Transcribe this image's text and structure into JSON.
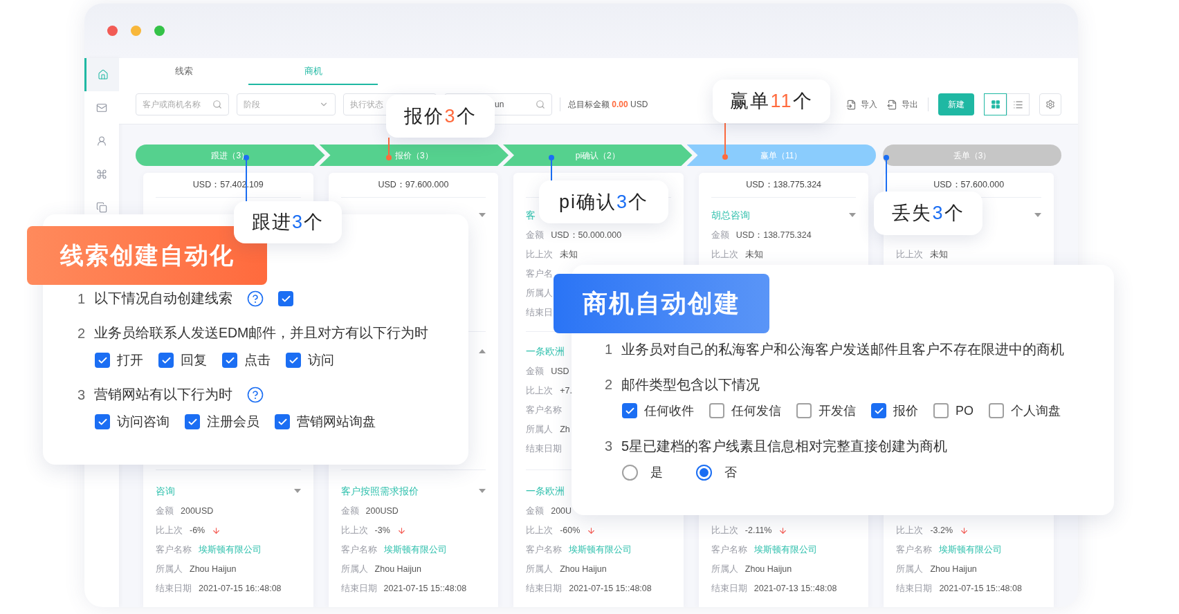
{
  "window": {
    "controls": [
      {
        "kind": "close"
      },
      {
        "kind": "minimize"
      },
      {
        "kind": "maximize"
      }
    ]
  },
  "sidebar": {
    "items": [
      {
        "kind": "home",
        "selected": true
      },
      {
        "kind": "mail",
        "selected": false
      },
      {
        "kind": "contacts",
        "selected": false
      },
      {
        "kind": "apps",
        "selected": false
      },
      {
        "kind": "documents",
        "selected": false
      }
    ]
  },
  "tabs": [
    {
      "label": "线索",
      "selected": false
    },
    {
      "label": "商机",
      "selected": true
    }
  ],
  "filters": {
    "search": {
      "placeholder": "客户或商机名称"
    },
    "stage": {
      "placeholder": "阶段"
    },
    "status": {
      "placeholder": "执行状态"
    },
    "owner": {
      "value": "un"
    }
  },
  "total_target": {
    "label": "总目标金额",
    "amount": "0.00",
    "currency": "USD"
  },
  "toolbar": {
    "import": "导入",
    "export": "导出",
    "create": "新建",
    "views": [
      {
        "kind": "grid",
        "selected": true
      },
      {
        "kind": "list",
        "selected": false
      }
    ]
  },
  "pipeline": [
    {
      "label": "跟进（3）",
      "kind": "start",
      "color": "#55d18e"
    },
    {
      "label": "报价（3）",
      "kind": "step",
      "color": "#55d18e"
    },
    {
      "label": "pi确认（2）",
      "kind": "step",
      "color": "#55d18e"
    },
    {
      "label": "赢单（11）",
      "kind": "end",
      "color": "#8accfd"
    },
    {
      "label": "丢单（3）",
      "kind": "closed",
      "color": "#c6c6c6"
    }
  ],
  "columns": [
    {
      "total": "USD：57.402.109",
      "bottom_card": {
        "title": "咨询",
        "expanded": false,
        "rows": [
          {
            "kind": "amount",
            "label": "金额",
            "value": "200USD"
          },
          {
            "kind": "change",
            "label": "比上次",
            "value": "-6%",
            "falling": true
          },
          {
            "kind": "customer",
            "label": "客户名称",
            "value": "埃斯顿有限公司"
          },
          {
            "kind": "owner",
            "label": "所属人",
            "value": "Zhou Haijun"
          },
          {
            "kind": "end_date",
            "label": "结束日期",
            "value": "2021-07-15 16::48:08"
          }
        ]
      }
    },
    {
      "total": "USD：97.600.000",
      "top_card": {
        "expanded": false
      },
      "middle_card": {
        "expanded": true
      },
      "bottom_card": {
        "title": "客户按照需求报价",
        "expanded": false,
        "rows": [
          {
            "kind": "amount",
            "label": "金额",
            "value": "200USD"
          },
          {
            "kind": "change",
            "label": "比上次",
            "value": "-3%",
            "falling": true
          },
          {
            "kind": "customer",
            "label": "客户名称",
            "value": "埃斯顿有限公司"
          },
          {
            "kind": "owner",
            "label": "所属人",
            "value": "Zhou Haijun"
          },
          {
            "kind": "end_date",
            "label": "结束日期",
            "value": "2021-07-15 15::48:08"
          }
        ]
      }
    },
    {
      "top_card": {
        "title": "客",
        "rows": [
          {
            "kind": "amount",
            "label": "金额",
            "value": "USD：50.000.000"
          },
          {
            "kind": "change",
            "label": "比上次",
            "value": "未知"
          },
          {
            "kind": "customer",
            "label": "客户名"
          },
          {
            "kind": "owner",
            "label": "所属人"
          },
          {
            "kind": "end_date",
            "label": "结束日"
          }
        ]
      },
      "middle_card": {
        "title": "一条欧洲",
        "rows": [
          {
            "kind": "amount",
            "label": "金额",
            "value": "USD"
          },
          {
            "kind": "change",
            "label": "比上次",
            "value": "+7."
          },
          {
            "kind": "customer",
            "label": "客户名称"
          },
          {
            "kind": "owner",
            "label": "所属人",
            "value": "Zh"
          },
          {
            "kind": "end_date",
            "label": "结束日期"
          }
        ]
      },
      "bottom_card": {
        "title": "一条欧洲",
        "rows": [
          {
            "kind": "amount",
            "label": "金额",
            "value": "200U"
          },
          {
            "kind": "change",
            "label": "比上次",
            "value": "-60%",
            "falling": true
          },
          {
            "kind": "customer",
            "label": "客户名称",
            "value": "埃斯顿有限公司"
          },
          {
            "kind": "owner",
            "label": "所属人",
            "value": "Zhou Haijun"
          },
          {
            "kind": "end_date",
            "label": "结束日期",
            "value": "2021-07-15 15::48:08"
          }
        ]
      }
    },
    {
      "total": "USD：138.775.324",
      "top_card": {
        "title": "胡总咨询",
        "expanded": false,
        "rows": [
          {
            "kind": "amount",
            "label": "金额",
            "value": "USD：138.775.324"
          },
          {
            "kind": "change",
            "label": "比上次",
            "value": "未知"
          }
        ]
      },
      "bottom_card": {
        "rows": [
          {
            "kind": "change",
            "label": "比上次",
            "value": "-2.11%",
            "falling": true
          },
          {
            "kind": "customer",
            "label": "客户名称",
            "value": "埃斯顿有限公司"
          },
          {
            "kind": "owner",
            "label": "所属人",
            "value": "Zhou Haijun"
          },
          {
            "kind": "end_date",
            "label": "结束日期",
            "value": "2021-07-13 15::48:08"
          }
        ]
      }
    },
    {
      "total": "USD：57.600.000",
      "top_card": {
        "expanded": false,
        "rows": [
          {
            "kind": "change",
            "label": "比上次",
            "value": "未知"
          }
        ]
      },
      "bottom_card": {
        "rows": [
          {
            "kind": "change",
            "label": "比上次",
            "value": "-3.2%",
            "falling": true
          },
          {
            "kind": "customer",
            "label": "客户名称",
            "value": "埃斯顿有限公司"
          },
          {
            "kind": "owner",
            "label": "所属人",
            "value": "Zhou Haijun"
          },
          {
            "kind": "end_date",
            "label": "结束日期",
            "value": "2021-07-15 15::48:08"
          }
        ]
      }
    }
  ],
  "callouts": [
    {
      "label": "跟进",
      "count": "3",
      "unit": "个",
      "color": "#1b6ef3"
    },
    {
      "label": "报价",
      "count": "3",
      "unit": "个",
      "color": "#ff6a3d"
    },
    {
      "label": "pi确认",
      "count": "3",
      "unit": "个",
      "color": "#1b6ef3"
    },
    {
      "label": "赢单",
      "count": "11",
      "unit": "个",
      "color": "#ff6a3d"
    },
    {
      "label": "丢失",
      "count": "3",
      "unit": "个",
      "color": "#1b6ef3"
    }
  ],
  "lead_panel": {
    "title": "线索创建自动化",
    "items": [
      {
        "number": "1",
        "text": "以下情况自动创建线索",
        "help": true,
        "checkbox": {
          "checked": true
        }
      },
      {
        "number": "2",
        "text": "业务员给联系人发送EDM邮件，并且对方有以下行为时",
        "help": false,
        "options": [
          {
            "label": "打开",
            "checked": true
          },
          {
            "label": "回复",
            "checked": true
          },
          {
            "label": "点击",
            "checked": true
          },
          {
            "label": "访问",
            "checked": true
          }
        ]
      },
      {
        "number": "3",
        "text": "营销网站有以下行为时",
        "help": true,
        "options": [
          {
            "label": "访问咨询",
            "checked": true
          },
          {
            "label": "注册会员",
            "checked": true
          },
          {
            "label": "营销网站询盘",
            "checked": true
          }
        ]
      }
    ]
  },
  "deal_panel": {
    "title": "商机自动创建",
    "items": [
      {
        "number": "1",
        "text": "业务员对自己的私海客户和公海客户发送邮件且客户不存在限进中的商机"
      },
      {
        "number": "2",
        "text": "邮件类型包含以下情况",
        "options": [
          {
            "label": "任何收件",
            "checked": true
          },
          {
            "label": "任何发信",
            "checked": false
          },
          {
            "label": "开发信",
            "checked": false
          },
          {
            "label": "报价",
            "checked": true
          },
          {
            "label": "PO",
            "checked": false
          },
          {
            "label": "个人询盘",
            "checked": false
          }
        ]
      },
      {
        "number": "3",
        "text": "5星已建档的客户线素且信息相对完整直接创建为商机",
        "choices": [
          {
            "label": "是",
            "selected": false
          },
          {
            "label": "否",
            "selected": true
          }
        ]
      }
    ]
  }
}
